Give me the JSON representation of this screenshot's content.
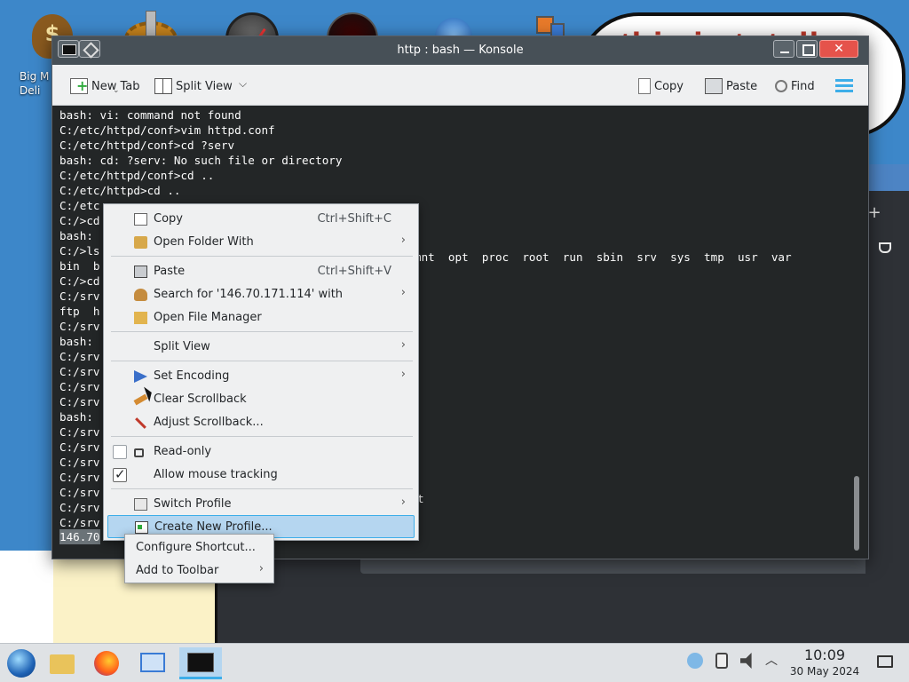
{
  "desktop": {
    "cloud_text": "this is totally",
    "bag_icon_label": "Big M\nDeli"
  },
  "window": {
    "title": "http : bash — Konsole"
  },
  "toolbar": {
    "new_tab": "New Tab",
    "split_view": "Split View",
    "copy": "Copy",
    "paste": "Paste",
    "find": "Find"
  },
  "terminal": {
    "lines": [
      "bash: vi: command not found",
      "C:/etc/httpd/conf>vim httpd.conf",
      "C:/etc/httpd/conf>cd ?serv",
      "bash: cd: ?serv: No such file or directory",
      "C:/etc/httpd/conf>cd ..",
      "C:/etc/httpd>cd ..",
      "C:/etc",
      "C:/>cd",
      "bash:",
      "C:/>ls",
      "bin  b",
      "C:/>cd",
      "C:/srv",
      "ftp  h",
      "C:/srv",
      "bash:",
      "C:/srv",
      "C:/srv",
      "C:/srv",
      "C:/srv",
      "bash:",
      "C:/srv",
      "C:/srv",
      "C:/srv",
      "C:/srv",
      "C:/srv",
      "C:/srv",
      "C:/srv"
    ],
    "ls_tail": "mnt  opt  proc  root  run  sbin  srv  sys  tmp  usr  var",
    "stray_char": "t",
    "prompt_selected": "146.70"
  },
  "context_menu": {
    "items": [
      {
        "label": "Copy",
        "shortcut": "Ctrl+Shift+C",
        "icon": "copy-icon"
      },
      {
        "label": "Open Folder With",
        "icon": "folder-icon"
      },
      {
        "label": "Paste",
        "shortcut": "Ctrl+Shift+V",
        "icon": "paste-icon"
      },
      {
        "label": "Search for '146.70.171.114' with",
        "icon": "search-icon"
      },
      {
        "label": "Open File Manager",
        "icon": "file-manager-icon"
      },
      {
        "label": "Split View"
      },
      {
        "label": "Set Encoding",
        "icon": "encoding-icon"
      },
      {
        "label": "Clear Scrollback",
        "icon": "broom-icon"
      },
      {
        "label": "Adjust Scrollback...",
        "icon": "tools-icon"
      },
      {
        "label": "Read-only",
        "checked": false,
        "icon": "lock-icon"
      },
      {
        "label": "Allow mouse tracking",
        "checked": true
      },
      {
        "label": "Switch Profile",
        "icon": "switch-profile-icon"
      },
      {
        "label": "Create New Profile...",
        "icon": "create-profile-icon"
      }
    ]
  },
  "submenu": {
    "items": [
      {
        "label": "Configure Shortcut..."
      },
      {
        "label": "Add to Toolbar"
      }
    ]
  },
  "taskbar": {
    "time": "10:09",
    "date": "30 May 2024"
  },
  "colors": {
    "accent": "#3daee9",
    "terminal_bg": "#232627",
    "titlebar": "#475057",
    "menu_highlight": "#b5d6f0"
  }
}
